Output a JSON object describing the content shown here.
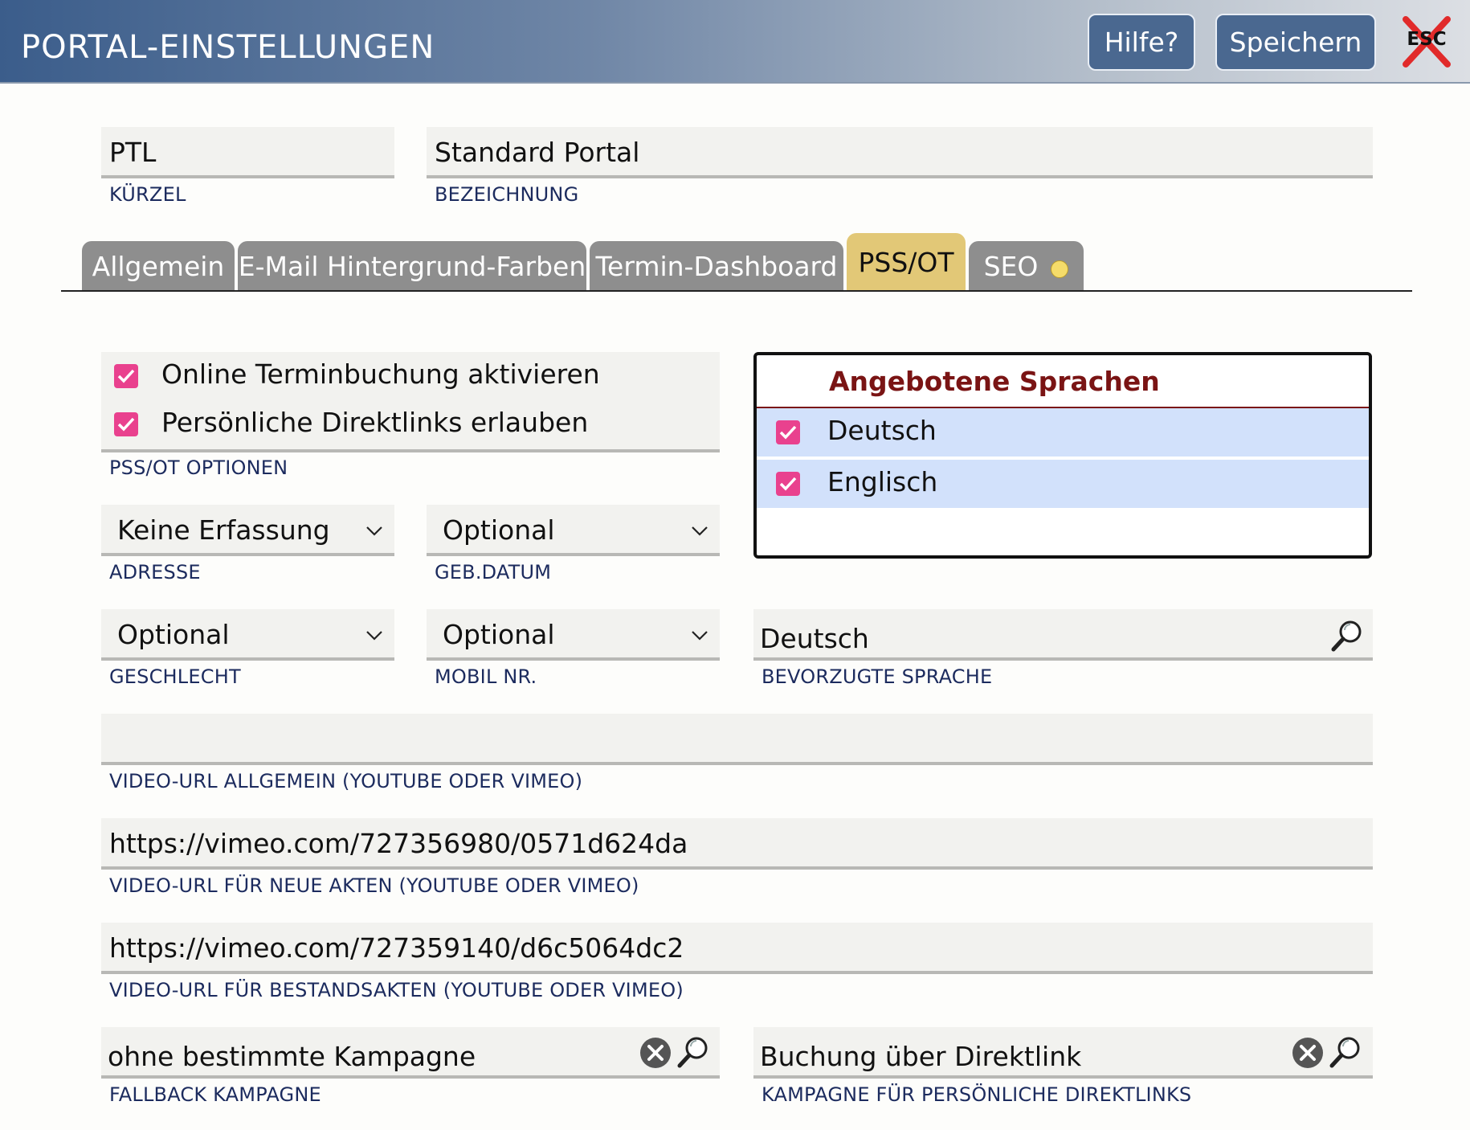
{
  "header": {
    "title": "PORTAL-EINSTELLUNGEN",
    "help_label": "Hilfe?",
    "save_label": "Speichern",
    "esc_label": "ESC"
  },
  "fields": {
    "kuerzel": {
      "value": "PTL",
      "label": "KÜRZEL"
    },
    "bezeichnung": {
      "value": "Standard Portal",
      "label": "BEZEICHNUNG"
    }
  },
  "tabs": [
    {
      "label": "Allgemein"
    },
    {
      "label": "E-Mail Hintergrund-Farben"
    },
    {
      "label": "Termin-Dashboard"
    },
    {
      "label": "PSS/OT",
      "active": true
    },
    {
      "label": "SEO",
      "indicator": "#f5dc6a"
    }
  ],
  "options": {
    "items": [
      {
        "label": "Online Terminbuchung aktivieren",
        "checked": true
      },
      {
        "label": "Persönliche Direktlinks erlauben",
        "checked": true
      }
    ],
    "label": "PSS/OT OPTIONEN"
  },
  "selects": {
    "adresse": {
      "value": "Keine Erfassung",
      "label": "ADRESSE"
    },
    "geb_datum": {
      "value": "Optional",
      "label": "GEB.DATUM"
    },
    "geschlecht": {
      "value": "Optional",
      "label": "GESCHLECHT"
    },
    "mobil": {
      "value": "Optional",
      "label": "MOBIL NR."
    }
  },
  "languages": {
    "title": "Angebotene Sprachen",
    "items": [
      {
        "label": "Deutsch",
        "checked": true
      },
      {
        "label": "Englisch",
        "checked": true
      }
    ]
  },
  "preferred_language": {
    "value": "Deutsch",
    "label": "BEVORZUGTE SPRACHE"
  },
  "video_urls": {
    "general": {
      "value": "",
      "label": "VIDEO-URL ALLGEMEIN (YOUTUBE ODER VIMEO)"
    },
    "new_files": {
      "value": "https://vimeo.com/727356980/0571d624da",
      "label": "VIDEO-URL FÜR NEUE AKTEN (YOUTUBE ODER VIMEO)"
    },
    "existing_files": {
      "value": "https://vimeo.com/727359140/d6c5064dc2",
      "label": "VIDEO-URL FÜR BESTANDSAKTEN (YOUTUBE ODER VIMEO)"
    }
  },
  "campaigns": {
    "fallback": {
      "value": "ohne bestimmte Kampagne",
      "label": "FALLBACK KAMPAGNE"
    },
    "direct": {
      "value": "Buchung über Direktlink",
      "label": "KAMPAGNE FÜR PERSÖNLICHE DIREKTLINKS"
    }
  },
  "colors": {
    "accent_header": "#3b5d8b",
    "checkbox": "#e9418e",
    "active_tab": "#e2c877",
    "label_text": "#1c2b5e",
    "language_title": "#7a1414",
    "language_row": "#d2e1fb"
  }
}
